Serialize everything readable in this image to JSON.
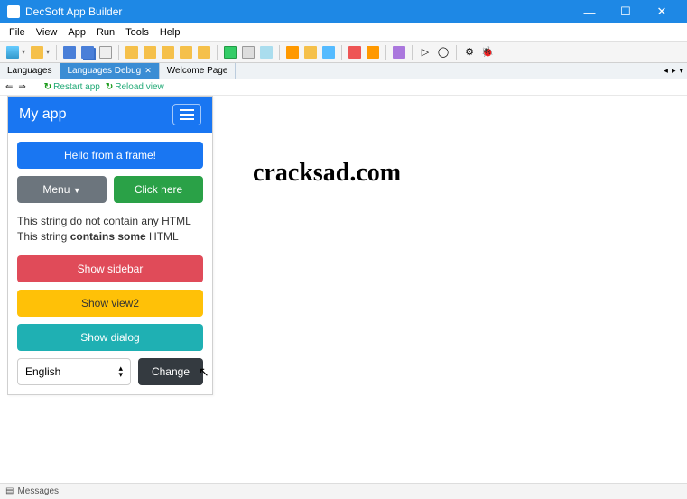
{
  "window": {
    "title": "DecSoft App Builder",
    "min": "—",
    "max": "☐",
    "close": "✕"
  },
  "menu": [
    "File",
    "View",
    "App",
    "Run",
    "Tools",
    "Help"
  ],
  "tabs": {
    "items": [
      {
        "label": "Languages",
        "active": false
      },
      {
        "label": "Languages Debug",
        "active": true
      },
      {
        "label": "Welcome Page",
        "active": false
      }
    ]
  },
  "debugbar": {
    "restart": "Restart app",
    "reload": "Reload view"
  },
  "app_preview": {
    "title": "My app",
    "hello_btn": "Hello from a frame!",
    "menu_btn": "Menu",
    "click_btn": "Click here",
    "text1": "This string do not contain any HTML",
    "text2_a": "This string ",
    "text2_b": "contains some",
    "text2_c": " HTML",
    "sidebar_btn": "Show sidebar",
    "view2_btn": "Show view2",
    "dialog_btn": "Show dialog",
    "lang_select": "English",
    "change_btn": "Change"
  },
  "watermark": "cracksad.com",
  "statusbar": {
    "label": "Messages"
  }
}
